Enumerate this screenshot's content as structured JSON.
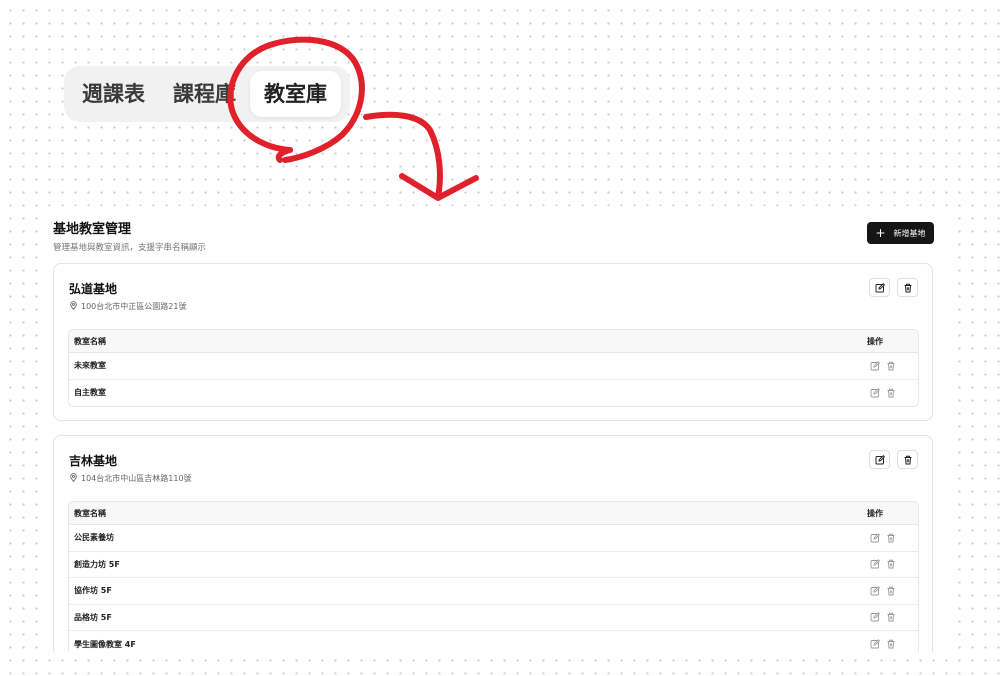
{
  "tabs": [
    {
      "label": "週課表"
    },
    {
      "label": "課程庫"
    },
    {
      "label": "教室庫"
    }
  ],
  "active_tab": "教室庫",
  "header": {
    "title": "基地教室管理",
    "subtitle": "管理基地與教室資訊，支援字串名稱顯示",
    "add_button_label": "新增基地"
  },
  "table_headers": {
    "name": "教室名稱",
    "actions": "操作"
  },
  "bases": [
    {
      "name": "弘道基地",
      "address": "100台北市中正區公園路21號",
      "rooms": [
        "未來教室",
        "自主教室"
      ]
    },
    {
      "name": "吉林基地",
      "address": "104台北市中山區吉林路110號",
      "rooms": [
        "公民素養坊",
        "創造力坊 5F",
        "協作坊 5F",
        "品格坊 5F",
        "學生圖像教室 4F"
      ]
    }
  ],
  "colors": {
    "annotation": "#e0202a",
    "primary_button": "#151515"
  },
  "icons": [
    "edit-icon",
    "trash-icon",
    "location-pin-icon",
    "plus-icon"
  ]
}
